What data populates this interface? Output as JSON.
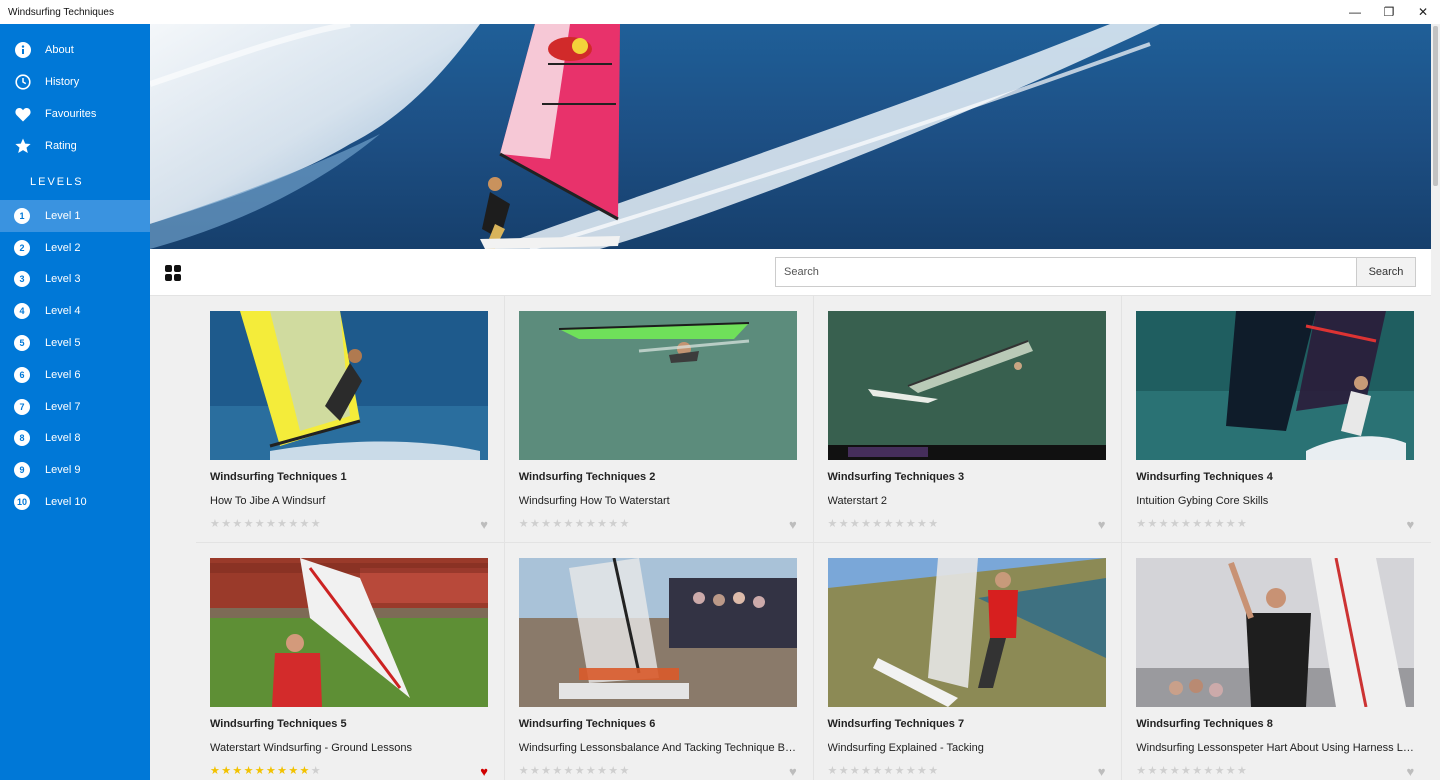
{
  "window": {
    "title": "Windsurfing Techniques",
    "controls": {
      "minimize": "—",
      "restore": "❐",
      "close": "✕"
    }
  },
  "sidebar": {
    "items": [
      {
        "label": "About",
        "icon": "info-icon"
      },
      {
        "label": "History",
        "icon": "clock-icon"
      },
      {
        "label": "Favourites",
        "icon": "heart-icon"
      },
      {
        "label": "Rating",
        "icon": "star-icon"
      }
    ],
    "levels_header": "LEVELS",
    "levels": [
      {
        "num": "1",
        "label": "Level 1",
        "active": true
      },
      {
        "num": "2",
        "label": "Level 2"
      },
      {
        "num": "3",
        "label": "Level 3"
      },
      {
        "num": "4",
        "label": "Level 4"
      },
      {
        "num": "5",
        "label": "Level 5"
      },
      {
        "num": "6",
        "label": "Level 6"
      },
      {
        "num": "7",
        "label": "Level 7"
      },
      {
        "num": "8",
        "label": "Level 8"
      },
      {
        "num": "9",
        "label": "Level 9"
      },
      {
        "num": "10",
        "label": "Level 10"
      }
    ]
  },
  "toolbar": {
    "search_placeholder": "Search",
    "search_button": "Search",
    "view_icon": "grid-view-icon"
  },
  "videos": [
    {
      "title": "Windsurfing Techniques 1",
      "subtitle": "How To Jibe A Windsurf",
      "rating": 0,
      "favourite": false
    },
    {
      "title": "Windsurfing Techniques 2",
      "subtitle": "Windsurfing How To Waterstart",
      "rating": 0,
      "favourite": false
    },
    {
      "title": "Windsurfing Techniques 3",
      "subtitle": "Waterstart 2",
      "rating": 0,
      "favourite": false
    },
    {
      "title": "Windsurfing Techniques 4",
      "subtitle": "Intuition Gybing Core Skills",
      "rating": 0,
      "favourite": false
    },
    {
      "title": "Windsurfing Techniques 5",
      "subtitle": "Waterstart Windsurfing - Ground Lessons",
      "rating": 9,
      "favourite": true
    },
    {
      "title": "Windsurfing Techniques 6",
      "subtitle": "Windsurfing Lessonsbalance And Tacking Technique By...",
      "rating": 0,
      "favourite": false
    },
    {
      "title": "Windsurfing Techniques 7",
      "subtitle": "Windsurfing Explained - Tacking",
      "rating": 0,
      "favourite": false
    },
    {
      "title": "Windsurfing Techniques 8",
      "subtitle": "Windsurfing Lessonspeter Hart About Using Harness Lines",
      "rating": 0,
      "favourite": false
    }
  ],
  "rating_max": 10,
  "colors": {
    "accent": "#0078d7",
    "active_level": "#3a93e0",
    "star_on": "#f2c200",
    "heart_on": "#d00000"
  }
}
